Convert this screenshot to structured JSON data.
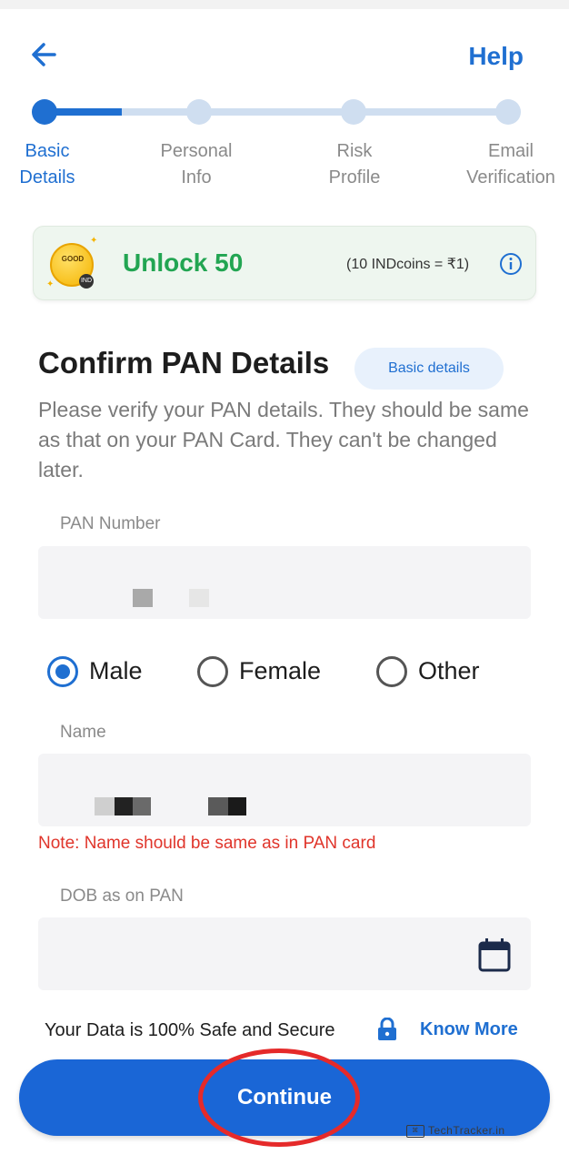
{
  "header": {
    "help_label": "Help"
  },
  "stepper": {
    "steps": [
      {
        "label": "Basic\nDetails",
        "active": true
      },
      {
        "label": "Personal\nInfo",
        "active": false
      },
      {
        "label": "Risk\nProfile",
        "active": false
      },
      {
        "label": "Email\nVerification",
        "active": false
      }
    ]
  },
  "reward": {
    "coin_text": "GOOD",
    "coin_badge": "IND",
    "unlock_text": "Unlock 50",
    "conversion_text": "(10 INDcoins = ₹1)"
  },
  "form": {
    "title": "Confirm PAN Details",
    "badge": "Basic details",
    "subtitle": "Please verify your PAN details. They should be same as that on your PAN Card. They can't be changed later.",
    "pan_label": "PAN Number",
    "gender_options": [
      "Male",
      "Female",
      "Other"
    ],
    "gender_selected": "Male",
    "name_label": "Name",
    "name_note": "Note: Name should be same as in PAN card",
    "dob_label": "DOB as on PAN"
  },
  "footer": {
    "safe_text": "Your Data is 100% Safe and Secure",
    "know_more": "Know More",
    "continue_label": "Continue",
    "watermark": "TechTracker.in"
  },
  "colors": {
    "primary": "#1f6fd1",
    "button": "#1a66d6",
    "reward_green": "#22a552",
    "note_red": "#e0352b",
    "highlight_ring": "#e52a2a"
  }
}
